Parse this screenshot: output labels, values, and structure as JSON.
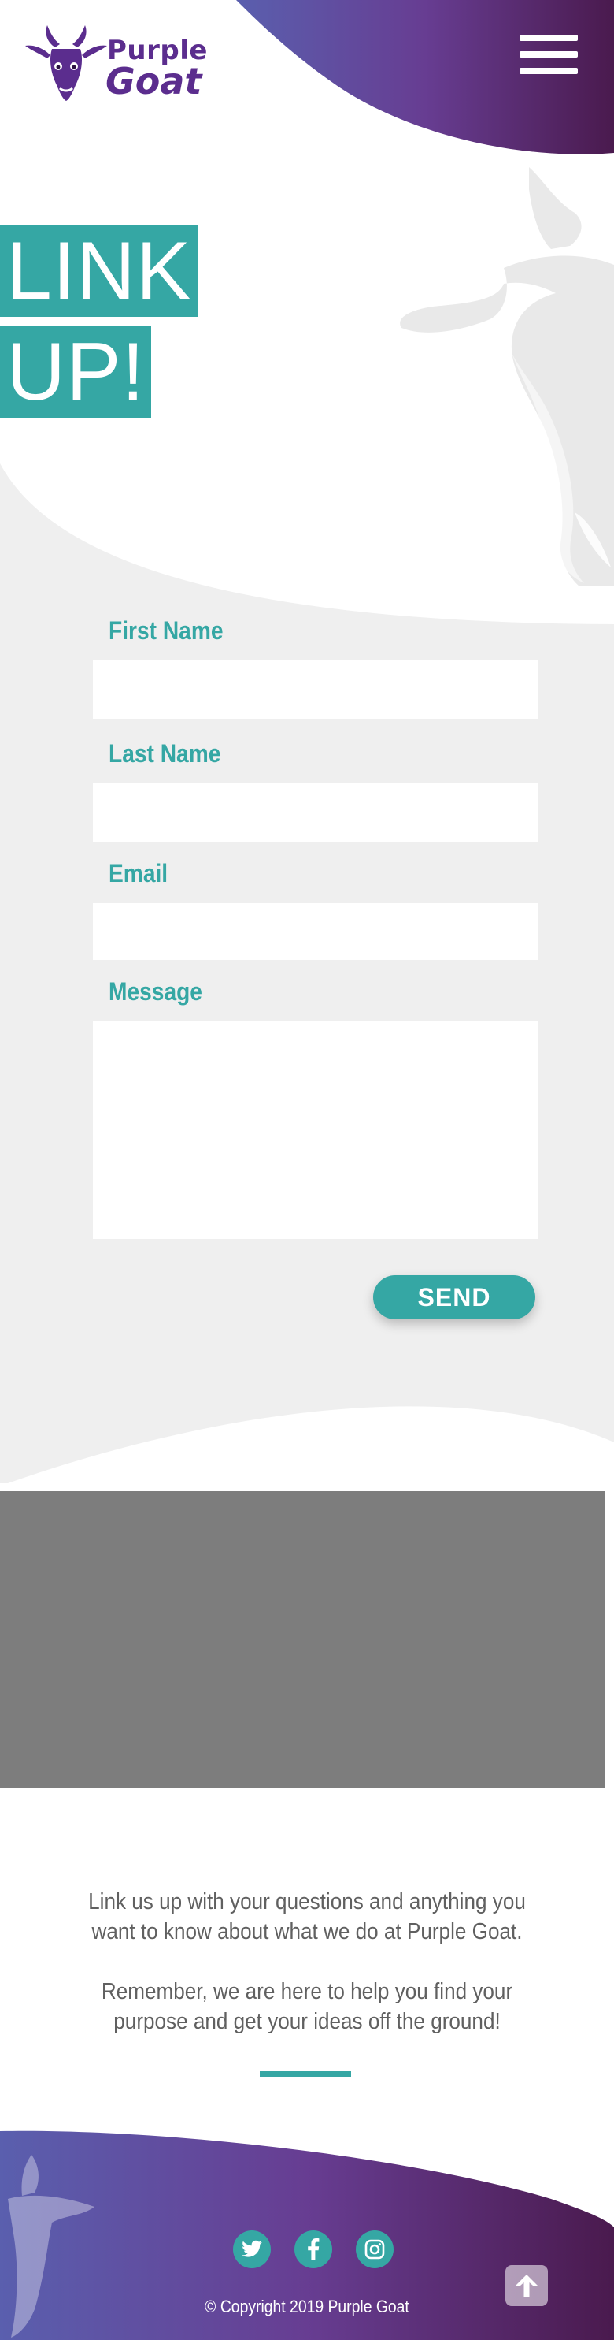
{
  "header": {
    "brand_line_1": "Purple",
    "brand_line_2": "Goat",
    "menu_icon": "hamburger-menu-icon"
  },
  "hero": {
    "title_line_1": "LINK",
    "title_line_2": "UP!"
  },
  "form": {
    "first_name_label": "First Name",
    "first_name_value": "",
    "last_name_label": "Last Name",
    "last_name_value": "",
    "email_label": "Email",
    "email_value": "",
    "message_label": "Message",
    "message_value": "",
    "send_label": "SEND"
  },
  "info": {
    "paragraph_1": "Link us up with your questions and anything you want to know about what we do at Purple Goat.",
    "paragraph_2": "Remember, we are here to help you find your purpose and get your ideas off the ground!"
  },
  "footer": {
    "social_icons": [
      "twitter-icon",
      "facebook-icon",
      "instagram-icon"
    ],
    "copyright": "© Copyright 2019 Purple Goat",
    "back_to_top_icon": "arrow-up-icon"
  },
  "colors": {
    "brand_purple": "#5b2d8e",
    "teal": "#35a7a4",
    "light_gray": "#efefef",
    "map_gray": "#7d7d7d",
    "gradient_start": "#5a5fae",
    "gradient_end": "#4a1a4e"
  }
}
